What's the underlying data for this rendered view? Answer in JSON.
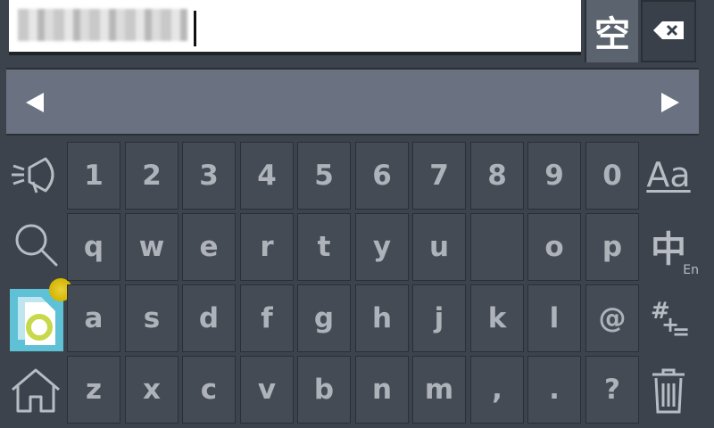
{
  "input": {
    "value": ""
  },
  "space_key": {
    "label": "空"
  },
  "icons": {
    "backspace": "backspace-icon",
    "prev": "arrow-left-icon",
    "next": "arrow-right-icon",
    "speak": "speaker-icon",
    "search": "search-icon",
    "document": "document-icon",
    "home": "home-icon",
    "delete": "trash-icon"
  },
  "keyboard": {
    "rows": [
      [
        "1",
        "2",
        "3",
        "4",
        "5",
        "6",
        "7",
        "8",
        "9",
        "0"
      ],
      [
        "q",
        "w",
        "e",
        "r",
        "t",
        "y",
        "u",
        "o",
        "p"
      ],
      [
        "a",
        "s",
        "d",
        "f",
        "g",
        "h",
        "j",
        "k",
        "l",
        "@"
      ],
      [
        "z",
        "x",
        "c",
        "v",
        "b",
        "n",
        "m",
        ",",
        ".",
        "?"
      ]
    ]
  },
  "right_panel": {
    "case_label": "Aa",
    "lang_label": "中",
    "lang_sub": "En",
    "sym_label": "#",
    "sym_plus": "+",
    "sym_eq": "="
  },
  "colors": {
    "active_button": "#5fc1d6",
    "cursor": "#d4b500"
  }
}
